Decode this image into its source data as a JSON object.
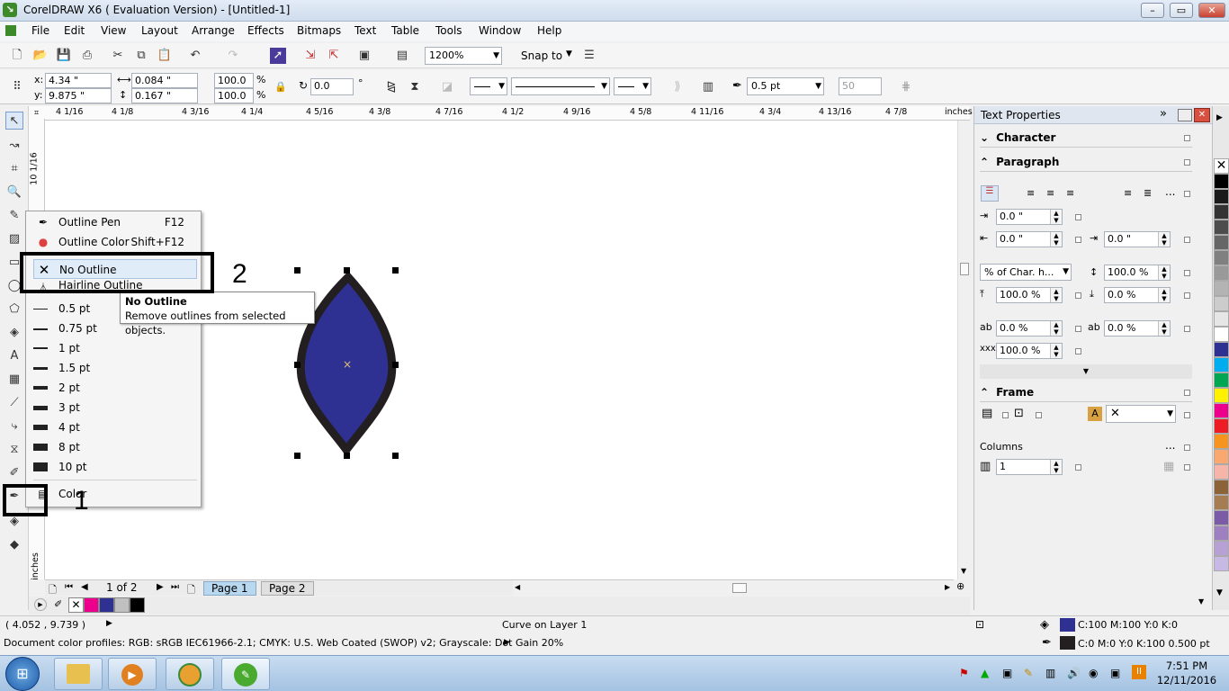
{
  "window": {
    "title": "CorelDRAW X6 ( Evaluation Version) - [Untitled-1]",
    "logo_glyph": "↘",
    "btn_min": "–",
    "btn_max": "▭",
    "btn_close": "✕"
  },
  "menu": [
    "File",
    "Edit",
    "View",
    "Layout",
    "Arrange",
    "Effects",
    "Bitmaps",
    "Text",
    "Table",
    "Tools",
    "Window",
    "Help"
  ],
  "toolbar1": {
    "zoom": "1200%",
    "snap_to": "Snap to"
  },
  "toolbar2": {
    "x_label": "x:",
    "x_value": "4.34 \"",
    "y_label": "y:",
    "y_value": "9.875 \"",
    "w_value": "0.084 \"",
    "h_value": "0.167 \"",
    "scale_w": "100.0",
    "scale_h": "100.0",
    "pct1": "%",
    "pct2": "%",
    "rotation": "0.0",
    "degree": "°",
    "outline_width": "0.5 pt",
    "miter": "50"
  },
  "ruler": {
    "unit": "inches",
    "ticks": [
      "4 1/16",
      "4 1/8",
      "4 3/16",
      "4 1/4",
      "4 5/16",
      "4 3/8",
      "4 7/16",
      "4 1/2",
      "4 9/16",
      "4 5/8",
      "4 11/16",
      "4 3/4",
      "4 13/16",
      "4 7/8"
    ],
    "v_label": "10 1/16",
    "v_unit": "inches"
  },
  "flyout": {
    "items": [
      {
        "label": "Outline Pen",
        "shortcut": "F12"
      },
      {
        "label": "Outline Color",
        "shortcut": "Shift+F12"
      },
      {
        "label": "No Outline",
        "shortcut": ""
      },
      {
        "label": "Hairline Outline",
        "shortcut": ""
      }
    ],
    "widths": [
      "0.5 pt",
      "0.75 pt",
      "1 pt",
      "1.5 pt",
      "2 pt",
      "3 pt",
      "4 pt",
      "8 pt",
      "10 pt"
    ],
    "color_label": "Color"
  },
  "tooltip": {
    "title": "No Outline",
    "desc": "Remove outlines from selected objects."
  },
  "annotations": {
    "one": "1",
    "two": "2"
  },
  "page_nav": {
    "counter": "1 of 2",
    "tabs": [
      "Page 1",
      "Page 2"
    ]
  },
  "docker": {
    "title": "Text Properties",
    "character": "Character",
    "paragraph": "Paragraph",
    "indent_first": "0.0 \"",
    "indent_left": "0.0 \"",
    "indent_right": "0.0 \"",
    "spacing_mode": "% of Char. h...",
    "line_spacing": "100.0 %",
    "before_para": "100.0 %",
    "after_para": "0.0 %",
    "char_spacing": "0.0 %",
    "word_spacing": "0.0 %",
    "lang_spacing": "100.0 %",
    "frame": "Frame",
    "columns_label": "Columns",
    "columns_value": "1",
    "ellipsis": "..."
  },
  "status": {
    "coords": "( 4.052 , 9.739 )",
    "object": "Curve on Layer 1",
    "fill": "C:100 M:100 Y:0 K:0",
    "outline": "C:0 M:0 Y:0 K:100  0.500 pt",
    "profiles": "Document color profiles: RGB: sRGB IEC61966-2.1; CMYK: U.S. Web Coated (SWOP) v2; Grayscale: Dot Gain 20%"
  },
  "clock": {
    "time": "7:51 PM",
    "date": "12/11/2016"
  },
  "colors": {
    "shape_fill": "#2e3192",
    "shape_outline": "#231f20",
    "accent": "#3d8a2a"
  }
}
